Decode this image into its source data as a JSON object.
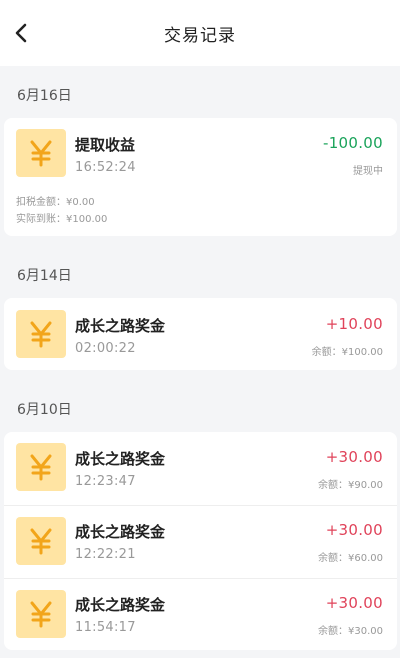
{
  "header": {
    "title": "交易记录",
    "back_icon": "chevron-left-icon"
  },
  "sections": [
    {
      "date": "6月16日",
      "items": [
        {
          "name": "提取收益",
          "time": "16:52:24",
          "amount": "-100.00",
          "sub": "提现中",
          "details": [
            "扣税金额：¥0.00",
            "实际到账：¥100.00"
          ]
        }
      ]
    },
    {
      "date": "6月14日",
      "items": [
        {
          "name": "成长之路奖金",
          "time": "02:00:22",
          "amount": "+10.00",
          "sub": "余额：¥100.00"
        }
      ]
    },
    {
      "date": "6月10日",
      "items": [
        {
          "name": "成长之路奖金",
          "time": "12:23:47",
          "amount": "+30.00",
          "sub": "余额：¥90.00"
        },
        {
          "name": "成长之路奖金",
          "time": "12:22:21",
          "amount": "+30.00",
          "sub": "余额：¥60.00"
        },
        {
          "name": "成长之路奖金",
          "time": "11:54:17",
          "amount": "+30.00",
          "sub": "余额：¥30.00"
        }
      ]
    }
  ],
  "colors": {
    "negative": "#1aa35a",
    "positive": "#e0435a",
    "coin_bg": "#ffe4a3",
    "coin_fg": "#f2a51a"
  }
}
